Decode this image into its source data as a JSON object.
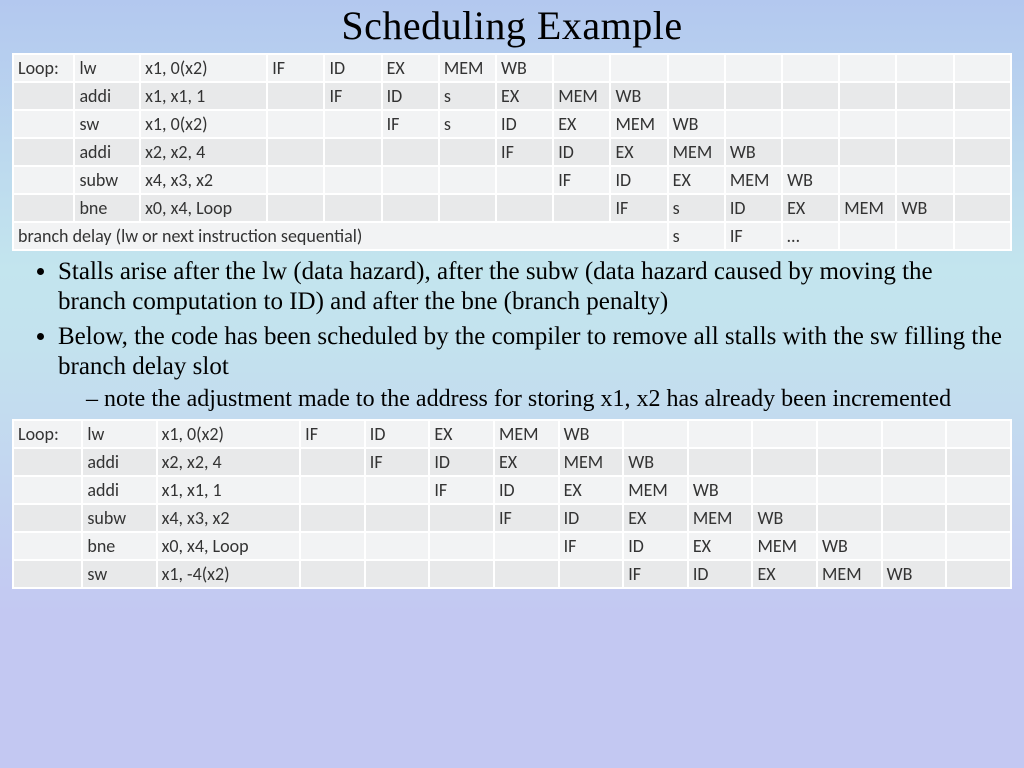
{
  "title": "Scheduling Example",
  "table1": {
    "rows": [
      {
        "label": "Loop:",
        "op": "lw",
        "args": "x1, 0(x2)",
        "stages": [
          "IF",
          "ID",
          "EX",
          "MEM",
          "WB",
          "",
          "",
          "",
          "",
          "",
          "",
          "",
          ""
        ]
      },
      {
        "label": "",
        "op": "addi",
        "args": "x1, x1, 1",
        "stages": [
          "",
          "IF",
          "ID",
          "s",
          "EX",
          "MEM",
          "WB",
          "",
          "",
          "",
          "",
          "",
          ""
        ]
      },
      {
        "label": "",
        "op": "sw",
        "args": "x1, 0(x2)",
        "stages": [
          "",
          "",
          "IF",
          "s",
          "ID",
          "EX",
          "MEM",
          "WB",
          "",
          "",
          "",
          "",
          ""
        ]
      },
      {
        "label": "",
        "op": "addi",
        "args": "x2, x2, 4",
        "stages": [
          "",
          "",
          "",
          "",
          "IF",
          "ID",
          "EX",
          "MEM",
          "WB",
          "",
          "",
          "",
          ""
        ]
      },
      {
        "label": "",
        "op": "subw",
        "args": "x4, x3, x2",
        "stages": [
          "",
          "",
          "",
          "",
          "",
          "IF",
          "ID",
          "EX",
          "MEM",
          "WB",
          "",
          "",
          ""
        ]
      },
      {
        "label": "",
        "op": "bne",
        "args": "x0, x4, Loop",
        "stages": [
          "",
          "",
          "",
          "",
          "",
          "",
          "IF",
          "s",
          "ID",
          "EX",
          "MEM",
          "WB",
          ""
        ]
      }
    ],
    "footer": {
      "label": "branch delay (lw or next instruction sequential)",
      "stages": [
        "s",
        "IF",
        "…",
        "",
        "",
        ""
      ]
    }
  },
  "bullets": [
    "Stalls arise after the lw (data hazard), after the subw (data hazard caused by moving the branch computation to ID) and after the bne (branch penalty)",
    "Below, the code has been scheduled by the compiler to remove all stalls with the sw filling the branch delay slot"
  ],
  "subbullets": [
    "note the adjustment made to the address for storing x1, x2 has already been incremented"
  ],
  "table2": {
    "rows": [
      {
        "label": "Loop:",
        "op": "lw",
        "args": "x1, 0(x2)",
        "stages": [
          "IF",
          "ID",
          "EX",
          "MEM",
          "WB",
          "",
          "",
          "",
          "",
          "",
          ""
        ]
      },
      {
        "label": "",
        "op": "addi",
        "args": "x2, x2, 4",
        "stages": [
          "",
          "IF",
          "ID",
          "EX",
          "MEM",
          "WB",
          "",
          "",
          "",
          "",
          ""
        ]
      },
      {
        "label": "",
        "op": "addi",
        "args": "x1, x1, 1",
        "stages": [
          "",
          "",
          "IF",
          "ID",
          "EX",
          "MEM",
          "WB",
          "",
          "",
          "",
          ""
        ]
      },
      {
        "label": "",
        "op": "subw",
        "args": "x4, x3, x2",
        "stages": [
          "",
          "",
          "",
          "IF",
          "ID",
          "EX",
          "MEM",
          "WB",
          "",
          "",
          ""
        ]
      },
      {
        "label": "",
        "op": "bne",
        "args": "x0, x4, Loop",
        "stages": [
          "",
          "",
          "",
          "",
          "IF",
          "ID",
          "EX",
          "MEM",
          "WB",
          "",
          ""
        ]
      },
      {
        "label": "",
        "op": "sw",
        "args": "x1, -4(x2)",
        "stages": [
          "",
          "",
          "",
          "",
          "",
          "IF",
          "ID",
          "EX",
          "MEM",
          "WB",
          ""
        ]
      }
    ]
  }
}
